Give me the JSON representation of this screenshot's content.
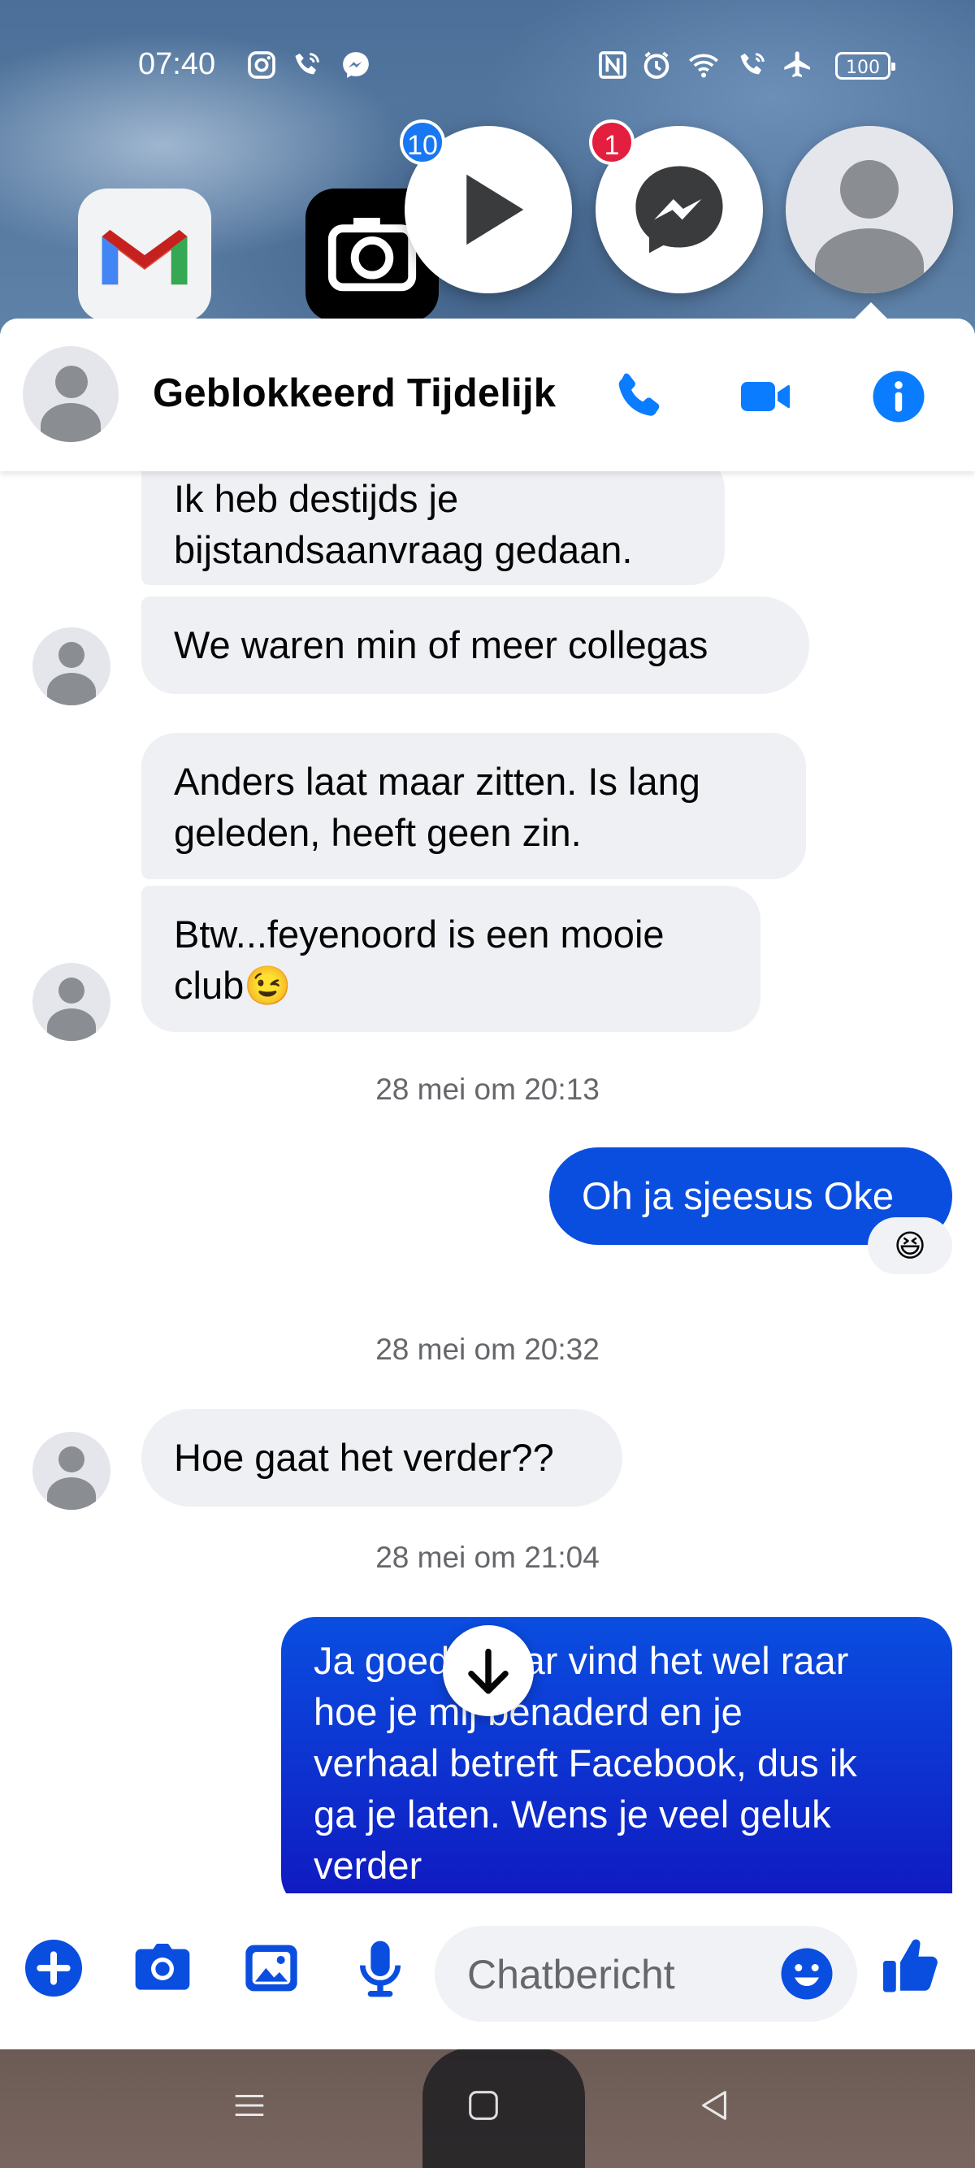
{
  "status_bar": {
    "time": "07:40",
    "battery": "100"
  },
  "chat_heads": {
    "video_badge": "10",
    "messenger_badge": "1"
  },
  "header": {
    "contact_name": "Geblokkeerd Tijdelijk"
  },
  "messages": {
    "m1": {
      "line1": "Ik heb destijds je",
      "line2": "bijstandsaanvraag gedaan."
    },
    "m2": {
      "line1": "We waren min of meer collegas"
    },
    "m3": {
      "line1": "Anders laat maar zitten. Is lang",
      "line2": "geleden, heeft geen zin."
    },
    "m4": {
      "line1": "Btw...feyenoord is een mooie",
      "line2": "club😉"
    },
    "ts1": "28 mei om 20:13",
    "m5": {
      "line1": "Oh ja sjeesus Oke",
      "reaction": "😆"
    },
    "ts2": "28 mei om 20:32",
    "m6": {
      "line1": "Hoe gaat het verder??"
    },
    "ts3": "28 mei om 21:04",
    "m7": {
      "line1": "Ja goed, maar vind het wel raar",
      "line2": "hoe je mij benaderd en je",
      "line3": "verhaal betreft Facebook, dus ik",
      "line4": "ga je laten. Wens je veel geluk",
      "line5": "verder"
    }
  },
  "composer": {
    "placeholder": "Chatbericht"
  },
  "colors": {
    "accent": "#0a7cff",
    "outgoing_bubble": "#0a4ee0",
    "incoming_bubble": "#eff0f3",
    "badge_blue": "#1877f2",
    "badge_red": "#e41e3f"
  }
}
